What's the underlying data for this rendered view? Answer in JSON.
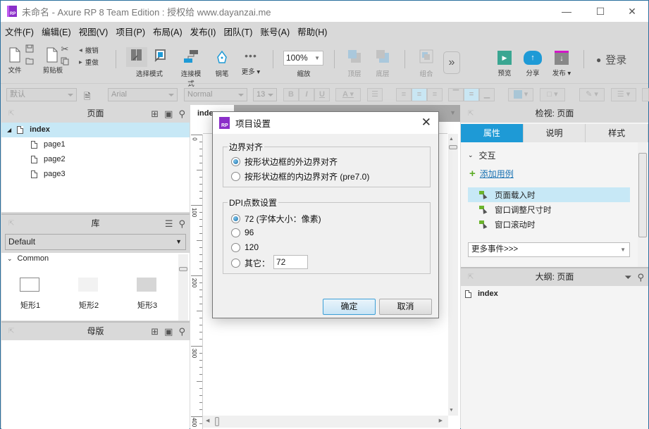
{
  "window": {
    "title": "未命名 - Axure RP 8 Team Edition : 授权给 www.dayanzai.me",
    "logo_text": "RP",
    "minimize": "—",
    "maximize": "☐",
    "close": "✕"
  },
  "menu": [
    "文件(F)",
    "编辑(E)",
    "视图(V)",
    "项目(P)",
    "布局(A)",
    "发布(I)",
    "团队(T)",
    "账号(A)",
    "帮助(H)"
  ],
  "toolbar": {
    "file": "文件",
    "clipboard": "剪贴板",
    "undo": "撤销",
    "redo": "重做",
    "select_mode": "选择模式",
    "connect_mode": "连接模式",
    "pen": "钢笔",
    "more": "更多",
    "zoom_value": "100%",
    "zoom_label": "缩放",
    "top_layer": "顶层",
    "bottom_layer": "底层",
    "group": "组合",
    "overflow": "»",
    "preview": "预览",
    "share": "分享",
    "publish": "发布",
    "login": "登录"
  },
  "format": {
    "style": "默认",
    "font": "Arial",
    "weight": "Normal",
    "size": "13",
    "bold": "B",
    "italic": "I",
    "underline": "U",
    "font_color": "A"
  },
  "pages_panel": {
    "title": "页面",
    "root": "index",
    "children": [
      "page1",
      "page2",
      "page3"
    ]
  },
  "library_panel": {
    "title": "库",
    "selected": "Default",
    "section": "Common",
    "items": [
      "矩形1",
      "矩形2",
      "矩形3"
    ]
  },
  "masters_panel": {
    "title": "母版"
  },
  "canvas": {
    "tab": "index",
    "ruler_marks": [
      "0",
      "100",
      "200",
      "300",
      "400"
    ]
  },
  "dialog": {
    "title": "项目设置",
    "close": "✕",
    "group1": {
      "legend": "边界对齐",
      "options": [
        "按形状边框的外边界对齐",
        "按形状边框的内边界对齐 (pre7.0)"
      ],
      "selected": 0
    },
    "group2": {
      "legend": "DPI点数设置",
      "options": [
        "72 (字体大小：像素)",
        "96",
        "120",
        "其它："
      ],
      "selected": 0,
      "other_value": "72"
    },
    "ok": "确定",
    "cancel": "取消"
  },
  "inspector": {
    "title": "检视: 页面",
    "tabs": [
      "属性",
      "说明",
      "样式"
    ],
    "active_tab": 0,
    "section": "交互",
    "add_case": "添加用例",
    "events": [
      "页面载入时",
      "窗口调整尺寸时",
      "窗口滚动时"
    ],
    "more_events": "更多事件>>>"
  },
  "outline": {
    "title": "大纲: 页面",
    "item": "index"
  },
  "colors": {
    "accent": "#1e9ad6",
    "logo": "#8b2fc9",
    "selection": "#c7e8f6",
    "event_icon": "#6bb52b"
  }
}
